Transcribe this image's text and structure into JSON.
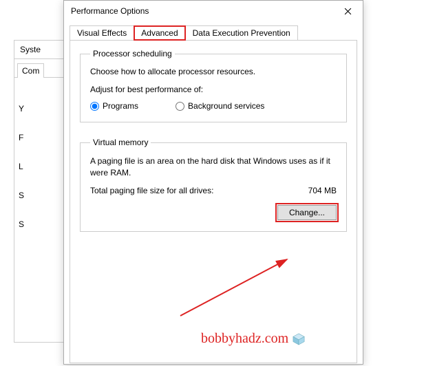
{
  "bg": {
    "title": "Syste",
    "tab": "Com",
    "line1": "Y",
    "line2": "F",
    "line3": "L",
    "line4": "S",
    "line5": "S"
  },
  "dialog": {
    "title": "Performance Options"
  },
  "tabs": {
    "visual": "Visual Effects",
    "advanced": "Advanced",
    "dep": "Data Execution Prevention"
  },
  "processor": {
    "legend": "Processor scheduling",
    "desc": "Choose how to allocate processor resources.",
    "adjust": "Adjust for best performance of:",
    "programs": "Programs",
    "background": "Background services"
  },
  "vm": {
    "legend": "Virtual memory",
    "desc": "A paging file is an area on the hard disk that Windows uses as if it were RAM.",
    "total_label": "Total paging file size for all drives:",
    "total_value": "704 MB",
    "change": "Change..."
  },
  "watermark": "bobbyhadz.com"
}
